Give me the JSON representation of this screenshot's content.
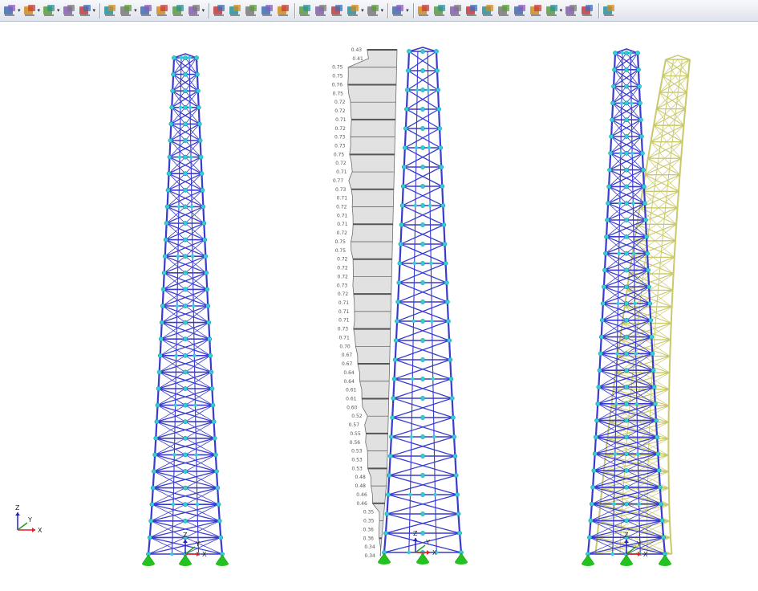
{
  "toolbar": {
    "groups": [
      [
        "new-model-icon",
        "open-model-icon",
        "display-model-icon",
        "isometric-view-icon",
        "render-icon"
      ],
      [
        "load-case-icon",
        "load-display-icon",
        "results-icon",
        "member-results-icon",
        "support-reactions-icon",
        "deformation-icon"
      ],
      [
        "select-icon",
        "zoom-window-icon",
        "zoom-icon",
        "view-cube-icon",
        "view-3d-icon"
      ],
      [
        "view-x-icon",
        "view-y-icon",
        "view-z-icon",
        "view-iso-icon",
        "view-rotate-icon"
      ],
      [
        "show-toggle-icon"
      ],
      [
        "member-line-icon",
        "section-icon",
        "surface-icon",
        "solid-icon",
        "color-palette-icon",
        "cube-icon",
        "coordinate-system-icon",
        "dimension-icon",
        "grid-icon",
        "panel-icon",
        "table-icon"
      ],
      [
        "help-icon"
      ]
    ],
    "dropdown_icons": [
      "new-model-icon",
      "open-model-icon",
      "display-model-icon",
      "render-icon",
      "load-display-icon",
      "deformation-icon",
      "view-iso-icon",
      "view-rotate-icon",
      "show-toggle-icon",
      "grid-icon"
    ]
  },
  "axes": {
    "x": "X",
    "y": "Y",
    "z": "Z"
  },
  "axis_colors": {
    "x": "#e02020",
    "y": "#20a020",
    "z": "#2020d0"
  },
  "colors": {
    "tower": "#3a3ad0",
    "node": "#2fd0d8",
    "support": "#22c31e",
    "deformed": "#c9c96a",
    "result_fill": "#c8c8c8",
    "result_edge": "#6e6e6e"
  },
  "result_values": [
    "0.43",
    "0.41",
    "0.75",
    "0.75",
    "0.76",
    "0.75",
    "0.72",
    "0.72",
    "0.71",
    "0.72",
    "0.73",
    "0.73",
    "0.75",
    "0.72",
    "0.71",
    "0.77",
    "0.73",
    "0.71",
    "0.72",
    "0.71",
    "0.71",
    "0.72",
    "0.75",
    "0.75",
    "0.72",
    "0.72",
    "0.72",
    "0.73",
    "0.72",
    "0.71",
    "0.71",
    "0.71",
    "0.73",
    "0.71",
    "0.70",
    "0.67",
    "0.67",
    "0.64",
    "0.64",
    "0.61",
    "0.61",
    "0.60",
    "0.52",
    "0.57",
    "0.55",
    "0.56",
    "0.53",
    "0.53",
    "0.53",
    "0.48",
    "0.48",
    "0.46",
    "0.46",
    "0.35",
    "0.35",
    "0.36",
    "0.36",
    "0.34",
    "0.34"
  ]
}
